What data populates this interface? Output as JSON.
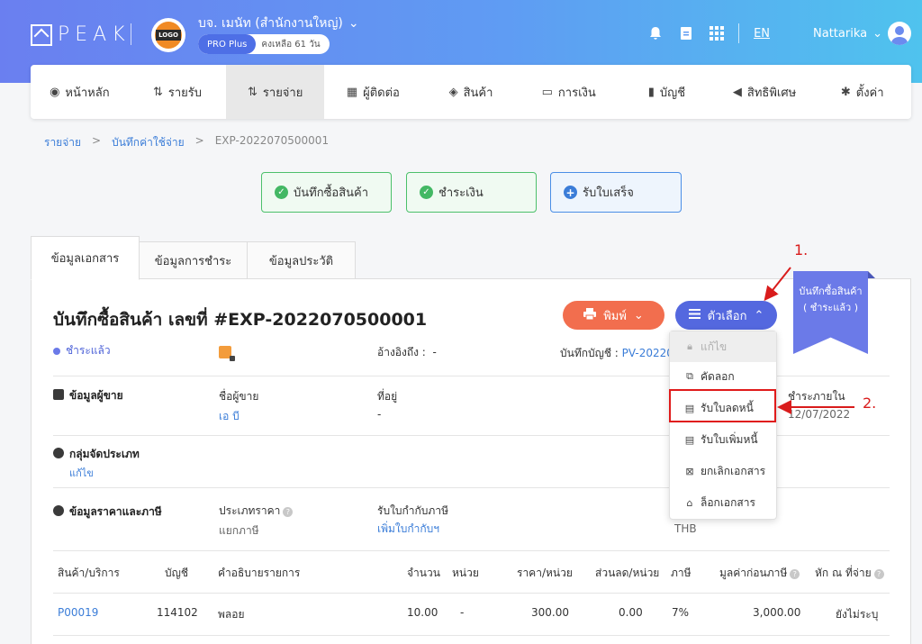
{
  "header": {
    "logo_text": "PEAK",
    "company_logo_text": "LOGO",
    "company_name": "บจ. เมนัท (สำนักงานใหญ่)",
    "plan": "PRO Plus",
    "plan_remaining": "คงเหลือ 61 วัน",
    "language": "EN",
    "user_name": "Nattarika"
  },
  "nav": {
    "items": [
      {
        "label": "หน้าหลัก",
        "icon": "dashboard-icon"
      },
      {
        "label": "รายรับ",
        "icon": "income-icon"
      },
      {
        "label": "รายจ่าย",
        "icon": "expense-icon",
        "active": true
      },
      {
        "label": "ผู้ติดต่อ",
        "icon": "contacts-icon"
      },
      {
        "label": "สินค้า",
        "icon": "product-icon"
      },
      {
        "label": "การเงิน",
        "icon": "money-icon"
      },
      {
        "label": "บัญชี",
        "icon": "accounting-icon"
      },
      {
        "label": "สิทธิพิเศษ",
        "icon": "megaphone-icon"
      },
      {
        "label": "ตั้งค่า",
        "icon": "gear-icon"
      }
    ]
  },
  "breadcrumb": {
    "level1": "รายจ่าย",
    "level2": "บันทึกค่าใช้จ่าย",
    "current": "EXP-2022070500001",
    "separator": ">"
  },
  "steps": {
    "purchase": "บันทึกซื้อสินค้า",
    "payment": "ชำระเงิน",
    "receipt": "รับใบเสร็จ"
  },
  "tabs": {
    "doc_info": "ข้อมูลเอกสาร",
    "payment_info": "ข้อมูลการชำระ",
    "history_info": "ข้อมูลประวัติ"
  },
  "document": {
    "title": "บันทึกซื้อสินค้า เลขที่ #EXP-2022070500001",
    "print_label": "พิมพ์",
    "options_label": "ตัวเลือก",
    "ribbon_line1": "บันทึกซื้อสินค้า",
    "ribbon_line2": "( ชำระแล้ว )",
    "status": "ชำระแล้ว",
    "reference_label": "อ้างอิงถึง :",
    "reference_value": "-",
    "journal_label": "บันทึกบัญชี :",
    "journal_value": "PV-202207"
  },
  "vendor": {
    "section": "ข้อมูลผู้ขาย",
    "name_label": "ชื่อผู้ขาย",
    "name_value": "เอ บี",
    "address_label": "ที่อยู่",
    "address_value": "-",
    "due_label": "ชำระภายใน",
    "due_value": "12/07/2022"
  },
  "category": {
    "section": "กลุ่มจัดประเภท",
    "edit": "แก้ไข"
  },
  "pricing": {
    "section": "ข้อมูลราคาและภาษี",
    "price_type_label": "ประเภทราคา",
    "price_type_value": "แยกภาษี",
    "tax_invoice_label": "รับใบกำกับภาษี",
    "tax_invoice_value": "เพิ่มใบกำกับฯ",
    "currency": "THB"
  },
  "dropdown": {
    "items": [
      "แก้ไข",
      "คัดลอก",
      "รับใบลดหนี้",
      "รับใบเพิ่มหนี้",
      "ยกเลิกเอกสาร",
      "ล็อกเอกสาร"
    ]
  },
  "annotations": {
    "step1": "1.",
    "step2": "2."
  },
  "table": {
    "headers": [
      "สินค้า/บริการ",
      "บัญชี",
      "คำอธิบายรายการ",
      "จำนวน",
      "หน่วย",
      "ราคา/หน่วย",
      "ส่วนลด/หน่วย",
      "ภาษี",
      "มูลค่าก่อนภาษี",
      "หัก ณ ที่จ่าย"
    ],
    "rows": [
      {
        "product": "P00019",
        "account": "114102",
        "description": "พลอย",
        "qty": "10.00",
        "unit": "-",
        "price": "300.00",
        "discount": "0.00",
        "tax": "7%",
        "amount": "3,000.00",
        "wht": "ยังไม่ระบุ"
      }
    ]
  }
}
